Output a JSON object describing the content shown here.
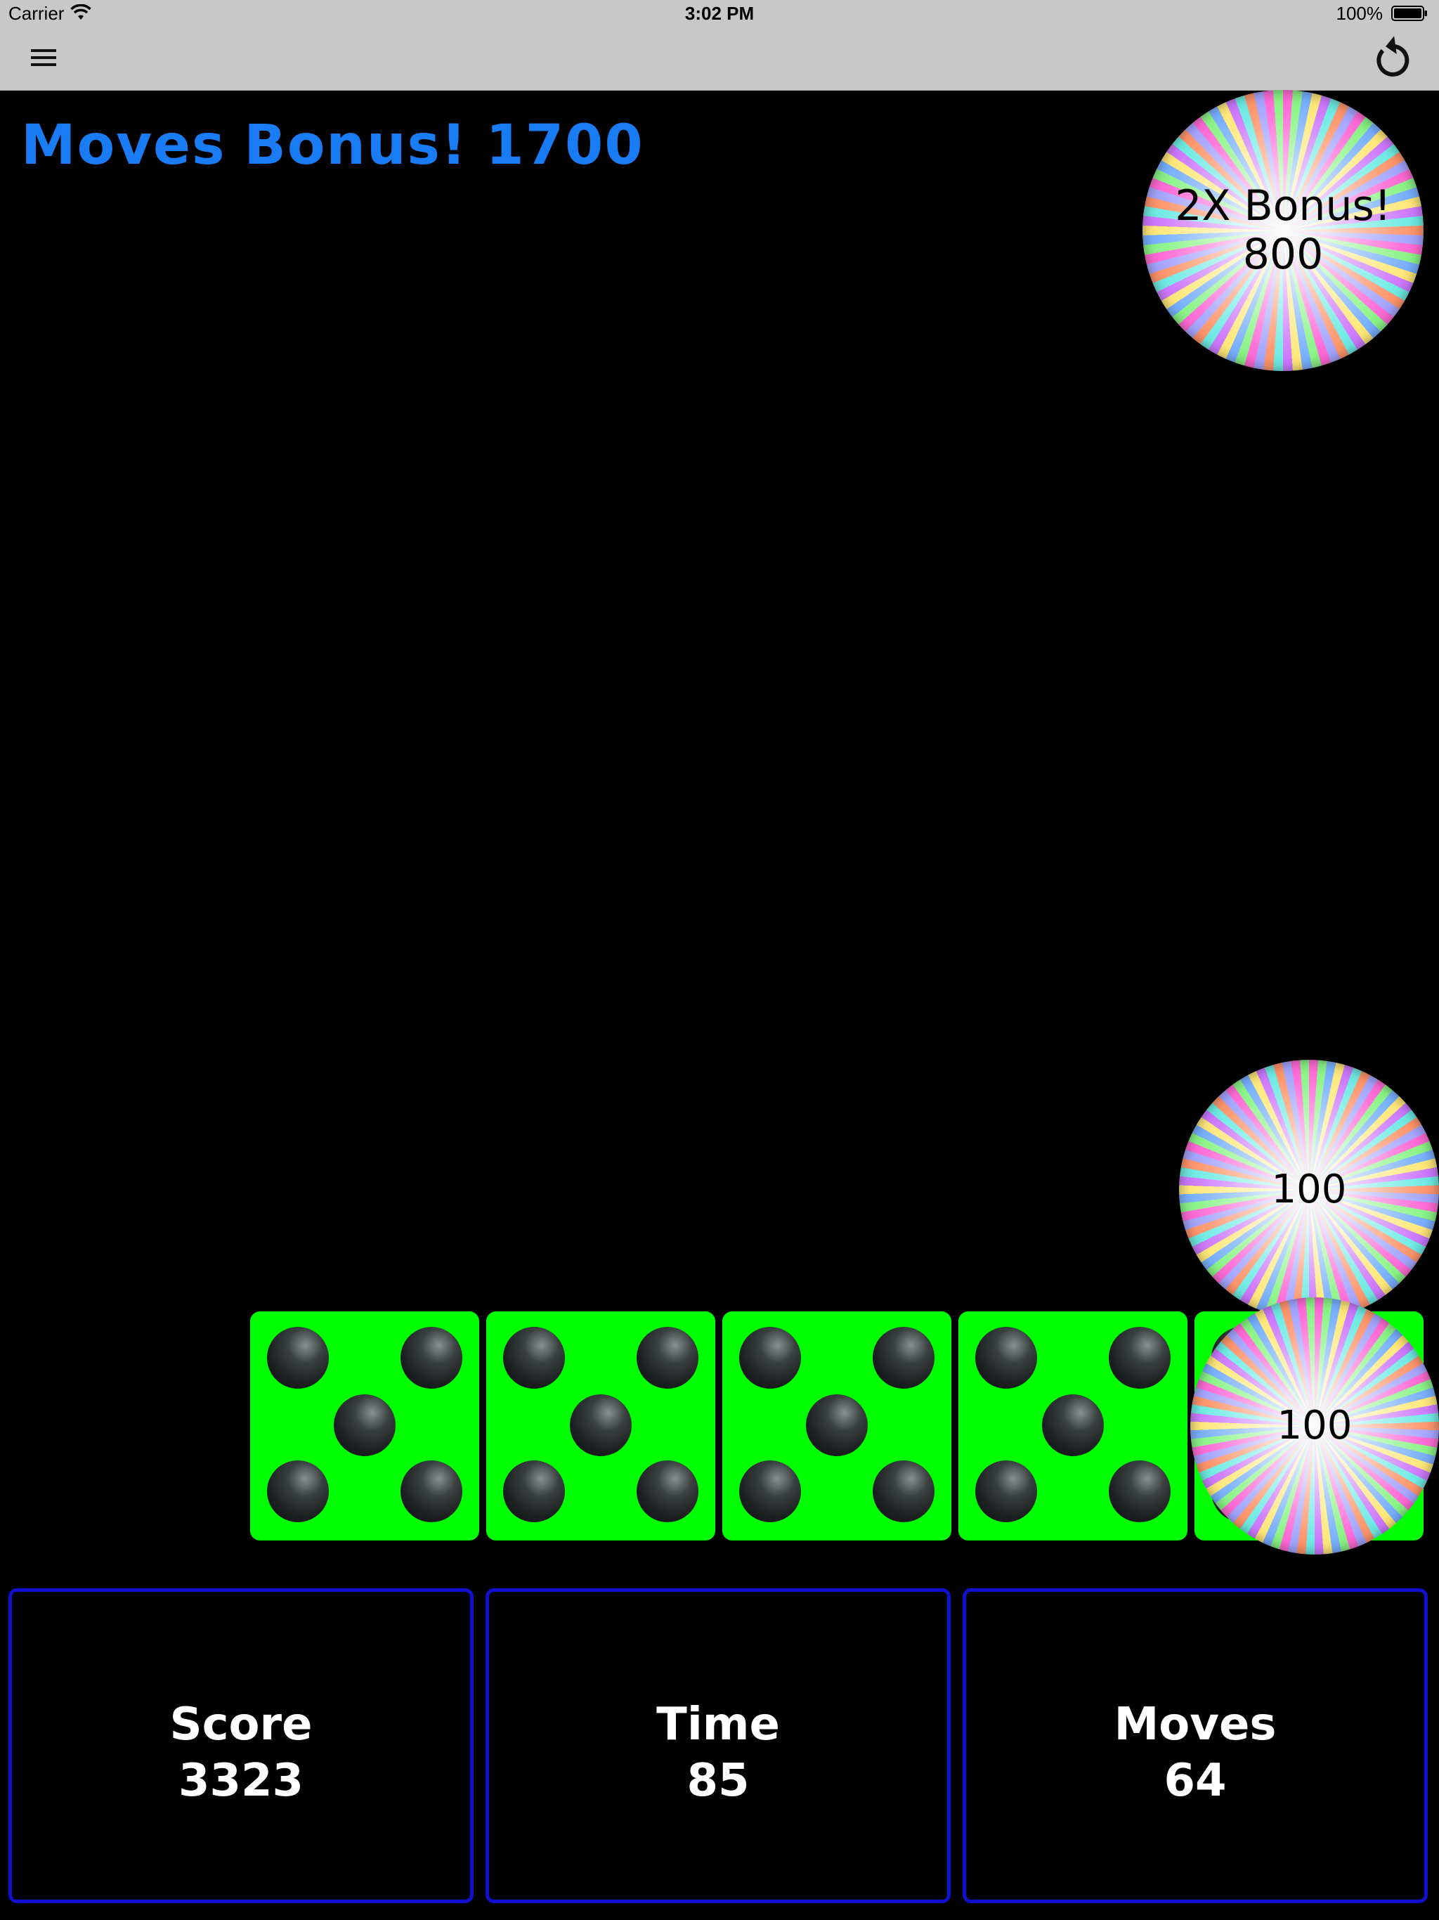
{
  "status_bar": {
    "carrier": "Carrier",
    "time": "3:02 PM",
    "battery": "100%"
  },
  "nav": {
    "menu_icon": "hamburger-menu-icon",
    "restart_icon": "restart-arrow-icon"
  },
  "banner": {
    "words": [
      "Moves",
      "Bonus!",
      "1700"
    ],
    "color": "#1a7cf4"
  },
  "orbs": {
    "top_right": {
      "line1": "2X Bonus!",
      "line2": "800"
    },
    "middle_right": {
      "label": "100"
    },
    "on_dice": {
      "label": "100"
    }
  },
  "dice": {
    "color": "#00ff00",
    "faces": [
      5,
      5,
      5,
      5,
      5
    ]
  },
  "stats": {
    "score": {
      "label": "Score",
      "value": "3323"
    },
    "time": {
      "label": "Time",
      "value": "85"
    },
    "moves": {
      "label": "Moves",
      "value": "64"
    },
    "border_color": "#1010d0"
  }
}
